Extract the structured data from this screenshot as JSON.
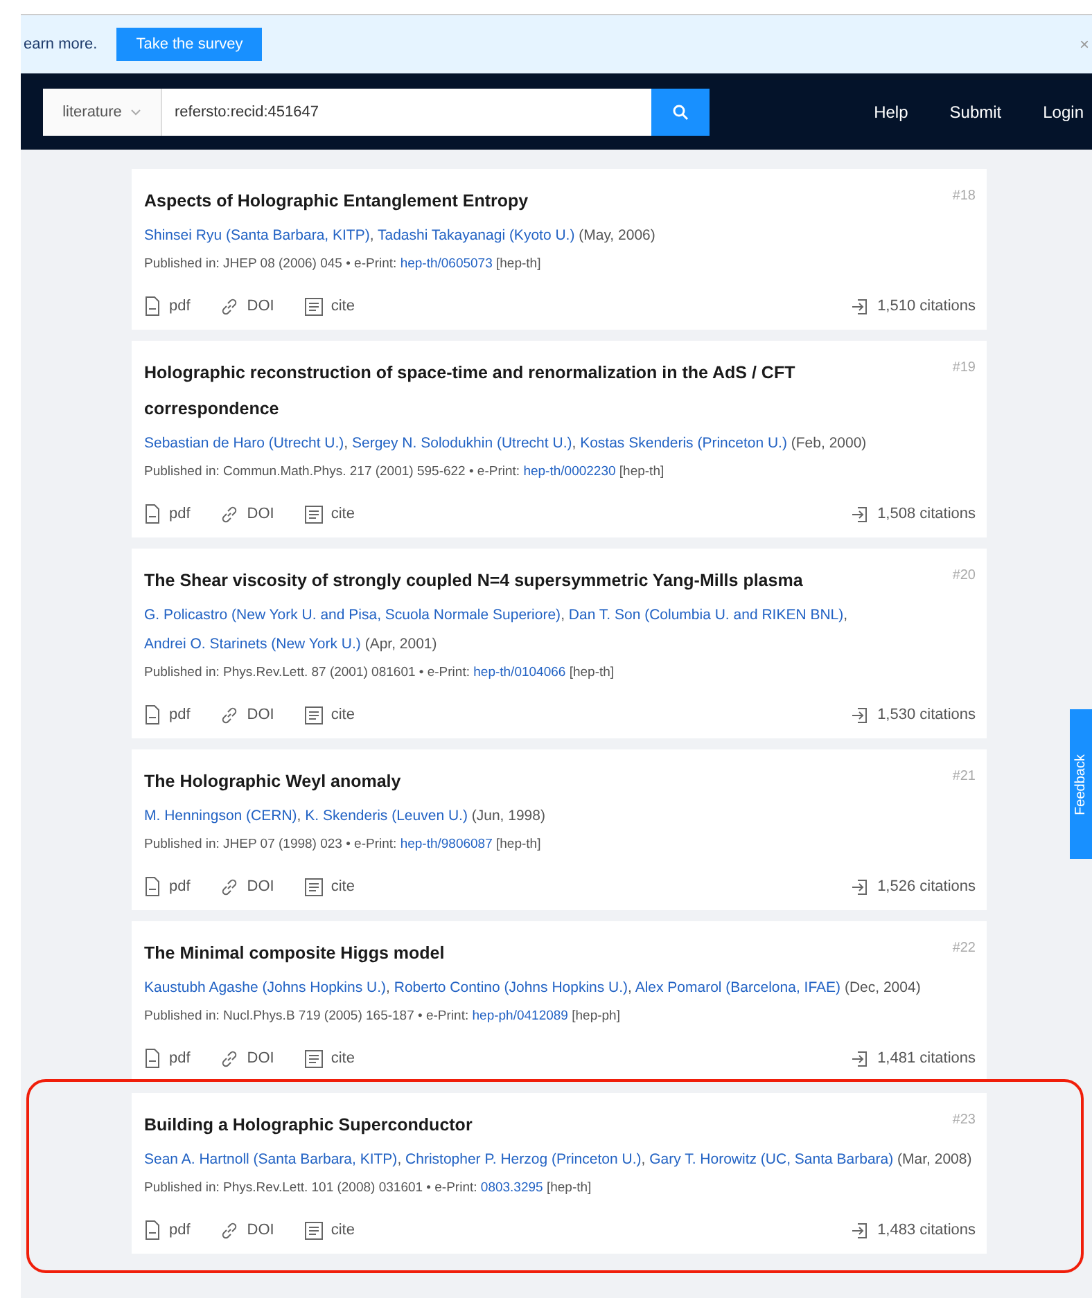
{
  "banner": {
    "text": "earn more.",
    "button": "Take the survey",
    "close": "×"
  },
  "header": {
    "collection": "literature",
    "query": "refersto:recid:451647",
    "nav": [
      "Help",
      "Submit",
      "Login"
    ]
  },
  "results": [
    {
      "number": "#18",
      "title": "Aspects of Holographic Entanglement Entropy",
      "authors": [
        {
          "name": "Shinsei Ryu (Santa Barbara, KITP)",
          "sep": ","
        },
        {
          "name": "Tadashi Takayanagi (Kyoto U.)"
        }
      ],
      "date": "(May, 2006)",
      "published": "Published in: JHEP 08 (2006) 045 •",
      "eprint_label": "e-Print:",
      "eprint": "hep-th/0605073",
      "category": "[hep-th]",
      "actions": [
        "pdf",
        "DOI",
        "cite"
      ],
      "citations": "1,510 citations",
      "highlighted": false
    },
    {
      "number": "#19",
      "title": "Holographic reconstruction of space-time and renormalization in the AdS / CFT correspondence",
      "authors": [
        {
          "name": "Sebastian de Haro (Utrecht U.)",
          "sep": ","
        },
        {
          "name": "Sergey N. Solodukhin (Utrecht U.)",
          "sep": ","
        },
        {
          "name": "Kostas Skenderis (Princeton U.)"
        }
      ],
      "date": "(Feb, 2000)",
      "published": "Published in: Commun.Math.Phys. 217 (2001) 595-622 •",
      "eprint_label": "e-Print:",
      "eprint": "hep-th/0002230",
      "category": "[hep-th]",
      "actions": [
        "pdf",
        "DOI",
        "cite"
      ],
      "citations": "1,508 citations",
      "highlighted": false
    },
    {
      "number": "#20",
      "title": "The Shear viscosity of strongly coupled N=4 supersymmetric Yang-Mills plasma",
      "authors": [
        {
          "name": "G. Policastro (New York U. and Pisa, Scuola Normale Superiore)",
          "sep": ","
        },
        {
          "name": "Dan T. Son (Columbia U. and RIKEN BNL)",
          "sep": ","
        },
        {
          "name": "Andrei O. Starinets (New York U.)"
        }
      ],
      "date": "(Apr, 2001)",
      "published": "Published in: Phys.Rev.Lett. 87 (2001) 081601 •",
      "eprint_label": "e-Print:",
      "eprint": "hep-th/0104066",
      "category": "[hep-th]",
      "actions": [
        "pdf",
        "DOI",
        "cite"
      ],
      "citations": "1,530 citations",
      "highlighted": false
    },
    {
      "number": "#21",
      "title": "The Holographic Weyl anomaly",
      "authors": [
        {
          "name": "M. Henningson (CERN)",
          "sep": ","
        },
        {
          "name": "K. Skenderis (Leuven U.)"
        }
      ],
      "date": "(Jun, 1998)",
      "published": "Published in: JHEP 07 (1998) 023 •",
      "eprint_label": "e-Print:",
      "eprint": "hep-th/9806087",
      "category": "[hep-th]",
      "actions": [
        "pdf",
        "DOI",
        "cite"
      ],
      "citations": "1,526 citations",
      "highlighted": false
    },
    {
      "number": "#22",
      "title": "The Minimal composite Higgs model",
      "authors": [
        {
          "name": "Kaustubh Agashe (Johns Hopkins U.)",
          "sep": ","
        },
        {
          "name": "Roberto Contino (Johns Hopkins U.)",
          "sep": ","
        },
        {
          "name": "Alex Pomarol (Barcelona, IFAE)"
        }
      ],
      "date": "(Dec, 2004)",
      "published": "Published in: Nucl.Phys.B 719 (2005) 165-187 •",
      "eprint_label": "e-Print:",
      "eprint": "hep-ph/0412089",
      "category": "[hep-ph]",
      "actions": [
        "pdf",
        "DOI",
        "cite"
      ],
      "citations": "1,481 citations",
      "highlighted": false
    },
    {
      "number": "#23",
      "title": "Building a Holographic Superconductor",
      "authors": [
        {
          "name": "Sean A. Hartnoll (Santa Barbara, KITP)",
          "sep": ","
        },
        {
          "name": "Christopher P. Herzog (Princeton U.)",
          "sep": ","
        },
        {
          "name": "Gary T. Horowitz (UC, Santa Barbara)"
        }
      ],
      "date": "(Mar, 2008)",
      "published": "Published in: Phys.Rev.Lett. 101 (2008) 031601 •",
      "eprint_label": "e-Print:",
      "eprint": "0803.3295",
      "category": "[hep-th]",
      "actions": [
        "pdf",
        "DOI",
        "cite"
      ],
      "citations": "1,483 citations",
      "highlighted": true
    }
  ],
  "feedback": "Feedback"
}
